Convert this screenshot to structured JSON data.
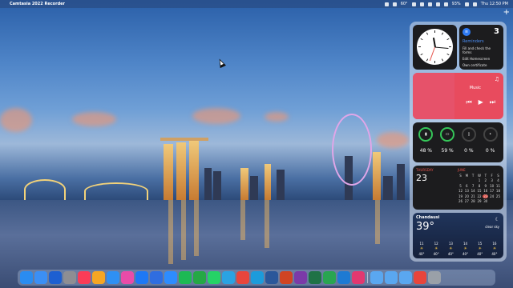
{
  "menubar": {
    "apple_icon": "apple-logo-icon",
    "app_name": "Camtasia 2022 Recorder",
    "status_text": "60°",
    "battery": "93%",
    "clock": "Thu 12:50 PM"
  },
  "widgets": {
    "reminders": {
      "count": "3",
      "title": "Reminders",
      "items": [
        "Fill and check the forms",
        "Edit Homescreen",
        "Own certificate"
      ]
    },
    "music": {
      "label": "Music"
    },
    "batteries": [
      {
        "icon": "phone-icon",
        "pct": "48 %",
        "level": 0.48
      },
      {
        "icon": "keyboard-icon",
        "pct": "59 %",
        "level": 0.59
      },
      {
        "icon": "watch-icon",
        "pct": "0 %",
        "level": 0
      },
      {
        "icon": "airpods-icon",
        "pct": "0 %",
        "level": 0
      }
    ],
    "calendar": {
      "weekday": "THURSDAY",
      "day": "23",
      "month": "JUNE",
      "headers": [
        "S",
        "M",
        "T",
        "W",
        "T",
        "F",
        "S"
      ],
      "rows": [
        [
          "",
          "",
          "",
          "1",
          "2",
          "3",
          "4"
        ],
        [
          "5",
          "6",
          "7",
          "8",
          "9",
          "10",
          "11"
        ],
        [
          "12",
          "13",
          "14",
          "15",
          "16",
          "17",
          "18"
        ],
        [
          "19",
          "20",
          "21",
          "22",
          "23",
          "24",
          "25"
        ],
        [
          "26",
          "27",
          "28",
          "29",
          "30",
          "",
          ""
        ]
      ],
      "today": "23"
    },
    "weather": {
      "city": "Chandausi",
      "temp": "39°",
      "desc": "clear sky",
      "hours": [
        {
          "time": "11",
          "temp": "40°"
        },
        {
          "time": "12",
          "temp": "40°"
        },
        {
          "time": "13",
          "temp": "40°"
        },
        {
          "time": "14",
          "temp": "40°"
        },
        {
          "time": "15",
          "temp": "40°"
        },
        {
          "time": "16",
          "temp": "40°"
        }
      ]
    }
  },
  "dock": {
    "items": [
      {
        "name": "finder",
        "color": "#2a8cf0"
      },
      {
        "name": "mail",
        "color": "#3b8ff5"
      },
      {
        "name": "calendar",
        "color": "#1d5fd1"
      },
      {
        "name": "system-preferences",
        "color": "#8e8e93"
      },
      {
        "name": "music",
        "color": "#fa3c57"
      },
      {
        "name": "photos",
        "color": "#f6a623"
      },
      {
        "name": "safari",
        "color": "#2f90f3"
      },
      {
        "name": "games",
        "color": "#e94ca8"
      },
      {
        "name": "app-store",
        "color": "#1e78f5"
      },
      {
        "name": "keynote",
        "color": "#2f6de0"
      },
      {
        "name": "zoom",
        "color": "#2d8cff"
      },
      {
        "name": "spotify",
        "color": "#1db954"
      },
      {
        "name": "xcode",
        "color": "#25a845"
      },
      {
        "name": "whatsapp",
        "color": "#25d366"
      },
      {
        "name": "telegram",
        "color": "#2aa3e3"
      },
      {
        "name": "chrome",
        "color": "#e8453c"
      },
      {
        "name": "edge",
        "color": "#1c9bdb"
      },
      {
        "name": "word",
        "color": "#2b579a"
      },
      {
        "name": "powerpoint",
        "color": "#d04423"
      },
      {
        "name": "onenote",
        "color": "#7b3aa8"
      },
      {
        "name": "excel",
        "color": "#1f7246"
      },
      {
        "name": "camtasia",
        "color": "#29a551"
      },
      {
        "name": "vscode",
        "color": "#1e7ad3"
      },
      {
        "name": "intellij",
        "color": "#e23870"
      },
      {
        "name": "folder",
        "color": "#5aa7f0"
      },
      {
        "name": "folder-2",
        "color": "#5aa7f0"
      },
      {
        "name": "downloads",
        "color": "#5aa7f0"
      },
      {
        "name": "screen-record",
        "color": "#e8453c"
      },
      {
        "name": "trash",
        "color": "#9aa0a8"
      }
    ]
  }
}
